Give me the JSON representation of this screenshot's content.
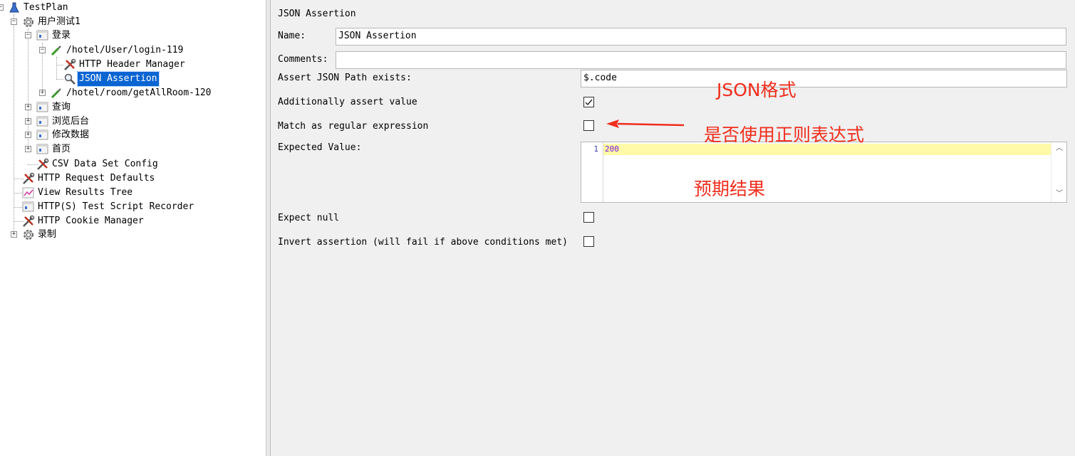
{
  "tree": {
    "items": [
      {
        "label": "TestPlan",
        "icon": "flask-icon"
      },
      {
        "label": "用户测试1",
        "icon": "gear-icon"
      },
      {
        "label": "登录",
        "icon": "controller-icon"
      },
      {
        "label": "/hotel/User/login-119",
        "icon": "pipette-icon"
      },
      {
        "label": "HTTP Header Manager",
        "icon": "wrench-icon"
      },
      {
        "label": "JSON Assertion",
        "icon": "magnifier-icon"
      },
      {
        "label": "/hotel/room/getAllRoom-120",
        "icon": "pipette-icon"
      },
      {
        "label": "查询",
        "icon": "controller-icon"
      },
      {
        "label": "浏览后台",
        "icon": "controller-icon"
      },
      {
        "label": "修改数据",
        "icon": "controller-icon"
      },
      {
        "label": "首页",
        "icon": "controller-icon"
      },
      {
        "label": "CSV Data Set Config",
        "icon": "wrench-icon"
      },
      {
        "label": "HTTP Request Defaults",
        "icon": "wrench-icon"
      },
      {
        "label": "View Results Tree",
        "icon": "chart-icon"
      },
      {
        "label": "HTTP(S) Test Script Recorder",
        "icon": "controller-icon"
      },
      {
        "label": "HTTP Cookie Manager",
        "icon": "wrench-icon"
      },
      {
        "label": "录制",
        "icon": "gear-icon"
      }
    ],
    "selected": "JSON Assertion"
  },
  "form": {
    "title": "JSON Assertion",
    "name_label": "Name:",
    "name_value": "JSON Assertion",
    "comments_label": "Comments:",
    "comments_value": "",
    "path_label": "Assert JSON Path exists:",
    "path_value": "$.code",
    "additional_label": "Additionally assert value",
    "additional_checked": true,
    "regex_label": "Match as regular expression",
    "regex_checked": false,
    "expected_label": "Expected Value:",
    "expected_line_no": "1",
    "expected_value": "200",
    "expect_null_label": "Expect null",
    "expect_null_checked": false,
    "invert_label": "Invert assertion (will fail if above conditions met)",
    "invert_checked": false
  },
  "annotations": {
    "json_format": "JSON格式",
    "use_regex": "是否使用正则表达式",
    "expected_result": "预期结果",
    "color": "#f02d1d"
  }
}
